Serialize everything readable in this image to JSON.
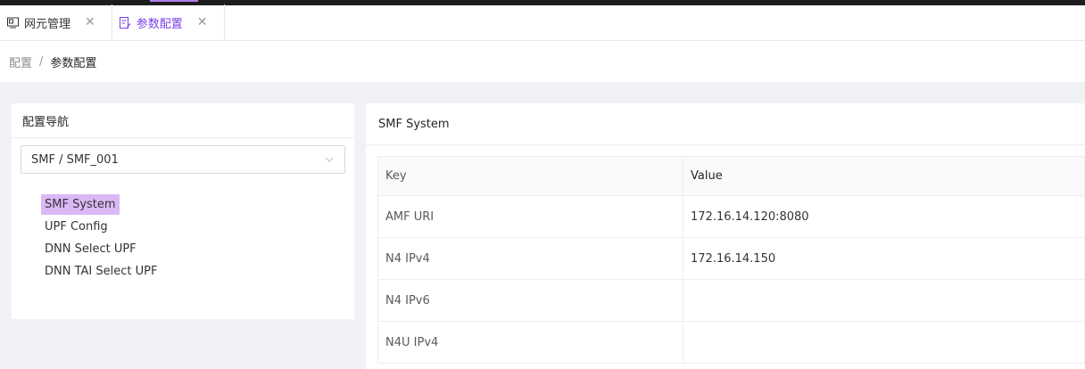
{
  "tabs": [
    {
      "label": "网元管理",
      "icon": "monitor-icon",
      "active": false
    },
    {
      "label": "参数配置",
      "icon": "edit-doc-icon",
      "active": true
    }
  ],
  "breadcrumb": {
    "first": "配置",
    "separator": "/",
    "last": "参数配置"
  },
  "left_panel": {
    "title": "配置导航",
    "select_value": "SMF / SMF_001",
    "nav_items": [
      "SMF System",
      "UPF Config",
      "DNN Select UPF",
      "DNN TAI Select UPF"
    ]
  },
  "right_panel": {
    "title": "SMF System",
    "columns": [
      "Key",
      "Value"
    ],
    "rows": [
      {
        "key": "AMF URI",
        "value": "172.16.14.120:8080"
      },
      {
        "key": "N4 IPv4",
        "value": "172.16.14.150"
      },
      {
        "key": "N4 IPv6",
        "value": ""
      },
      {
        "key": "N4U IPv4",
        "value": ""
      }
    ]
  },
  "colors": {
    "accent": "#7b3fe4",
    "nav_active_bg": "#dbb8f5"
  }
}
